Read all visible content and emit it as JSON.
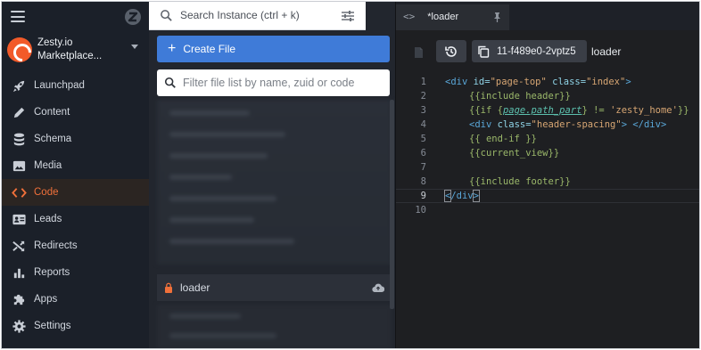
{
  "nav": {
    "instance_name_line1": "Zesty.io",
    "instance_name_line2": "Marketplace...",
    "items": [
      {
        "label": "Launchpad",
        "icon": "rocket-icon"
      },
      {
        "label": "Content",
        "icon": "pencil-icon"
      },
      {
        "label": "Schema",
        "icon": "database-icon"
      },
      {
        "label": "Media",
        "icon": "image-icon"
      },
      {
        "label": "Code",
        "icon": "code-icon",
        "active": true
      },
      {
        "label": "Leads",
        "icon": "contact-card-icon"
      },
      {
        "label": "Redirects",
        "icon": "shuffle-icon"
      },
      {
        "label": "Reports",
        "icon": "bar-chart-icon"
      },
      {
        "label": "Apps",
        "icon": "puzzle-icon"
      },
      {
        "label": "Settings",
        "icon": "gear-icon"
      }
    ],
    "active_color": "#f0703a"
  },
  "instance_search": {
    "placeholder": "Search Instance (ctrl + k)"
  },
  "files": {
    "create_label": "Create File",
    "create_color": "#3f7bd8",
    "filter_placeholder": "Filter file list by name, zuid or code",
    "selected_file": "loader"
  },
  "editor": {
    "tab_label": "*loader",
    "zuid": "11-f489e0-2vptz5",
    "file_name": "loader",
    "lines": [
      {
        "n": "1"
      },
      {
        "n": "2"
      },
      {
        "n": "3"
      },
      {
        "n": "4"
      },
      {
        "n": "5"
      },
      {
        "n": "6"
      },
      {
        "n": "7"
      },
      {
        "n": "8"
      },
      {
        "n": "9"
      },
      {
        "n": "10"
      }
    ],
    "code": {
      "l1": {
        "open": "<div ",
        "a1": "id=",
        "v1": "\"page-top\"",
        "a2": " class=",
        "v2": "\"index\"",
        "close": ">"
      },
      "l2": {
        "text": "{{include header}}"
      },
      "l3": {
        "open": "{{if {",
        "var": "page.path_part",
        "mid": "} != ",
        "str": "'zesty_home'",
        "close": "}}"
      },
      "l4": {
        "open": "<div ",
        "a1": "class=",
        "v1": "\"header-spacing\"",
        "close": "> </div>"
      },
      "l5": {
        "text": "{{ end-if }}"
      },
      "l6": {
        "text": "{{current_view}}"
      },
      "l7": {
        "text": ""
      },
      "l8": {
        "text": "{{include footer}}"
      },
      "l9": {
        "open": "<",
        "tag": "/div",
        "close": ">"
      },
      "l10": {
        "text": ""
      }
    }
  }
}
